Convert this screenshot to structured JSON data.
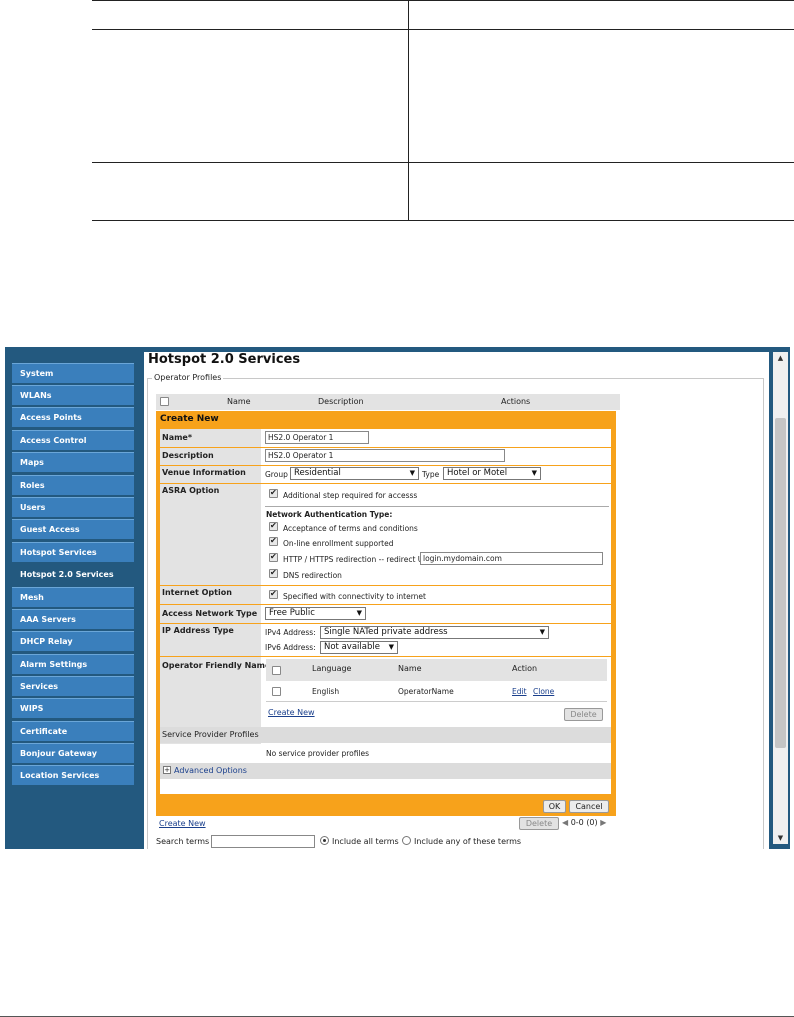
{
  "app": {
    "page_title": "Hotspot 2.0 Services",
    "section_legend": "Operator Profiles"
  },
  "sidebar": {
    "items": [
      {
        "label": "System"
      },
      {
        "label": "WLANs"
      },
      {
        "label": "Access Points"
      },
      {
        "label": "Access Control"
      },
      {
        "label": "Maps"
      },
      {
        "label": "Roles"
      },
      {
        "label": "Users"
      },
      {
        "label": "Guest Access"
      },
      {
        "label": "Hotspot Services"
      },
      {
        "label": "Hotspot 2.0 Services",
        "active": true
      },
      {
        "label": "Mesh"
      },
      {
        "label": "AAA Servers"
      },
      {
        "label": "DHCP Relay"
      },
      {
        "label": "Alarm Settings"
      },
      {
        "label": "Services"
      },
      {
        "label": "WIPS"
      },
      {
        "label": "Certificate"
      },
      {
        "label": "Bonjour Gateway"
      },
      {
        "label": "Location Services"
      }
    ]
  },
  "profiles_table": {
    "columns": [
      "Name",
      "Description",
      "Actions"
    ]
  },
  "create_new": {
    "title": "Create New",
    "name_label": "Name*",
    "name_value": "HS2.0 Operator 1",
    "description_label": "Description",
    "description_value": "HS2.0 Operator 1",
    "venue_label": "Venue Information",
    "group_label": "Group",
    "group_value": "Residential",
    "type_label": "Type",
    "type_value": "Hotel or Motel",
    "asra_label": "ASRA Option",
    "asra_checkbox": "Additional step required for accesss",
    "nat_heading": "Network Authentication Type:",
    "nat_options": {
      "terms": "Acceptance of terms and conditions",
      "enrollment": "On-line enrollment supported",
      "redirect": "HTTP / HTTPS redirection -- redirect URL:",
      "dns": "DNS redirection"
    },
    "redirect_url": "login.mydomain.com",
    "internet_label": "Internet Option",
    "internet_checkbox": "Specified with connectivity to internet",
    "access_network_label": "Access Network Type",
    "access_network_value": "Free Public",
    "ip_label": "IP Address Type",
    "ipv4_label": "IPv4 Address:",
    "ipv4_value": "Single NATed private address",
    "ipv6_label": "IPv6 Address:",
    "ipv6_value": "Not available",
    "friendly_label": "Operator Friendly Name",
    "friendly_columns": {
      "language": "Language",
      "name": "Name",
      "action": "Action"
    },
    "friendly_row": {
      "language": "English",
      "name": "OperatorName",
      "edit": "Edit",
      "clone": "Clone"
    },
    "friendly_create": "Create New",
    "friendly_delete": "Delete",
    "sp_section": "Service Provider Profiles",
    "sp_empty": "No service provider profiles",
    "advanced": "Advanced Options",
    "advanced_toggle": "+",
    "ok": "OK",
    "cancel": "Cancel"
  },
  "footer_bar": {
    "create_new": "Create New",
    "delete": "Delete",
    "pager": "0-0 (0)",
    "search_label": "Search terms",
    "include_all": "Include all terms",
    "include_any": "Include any of these terms"
  }
}
